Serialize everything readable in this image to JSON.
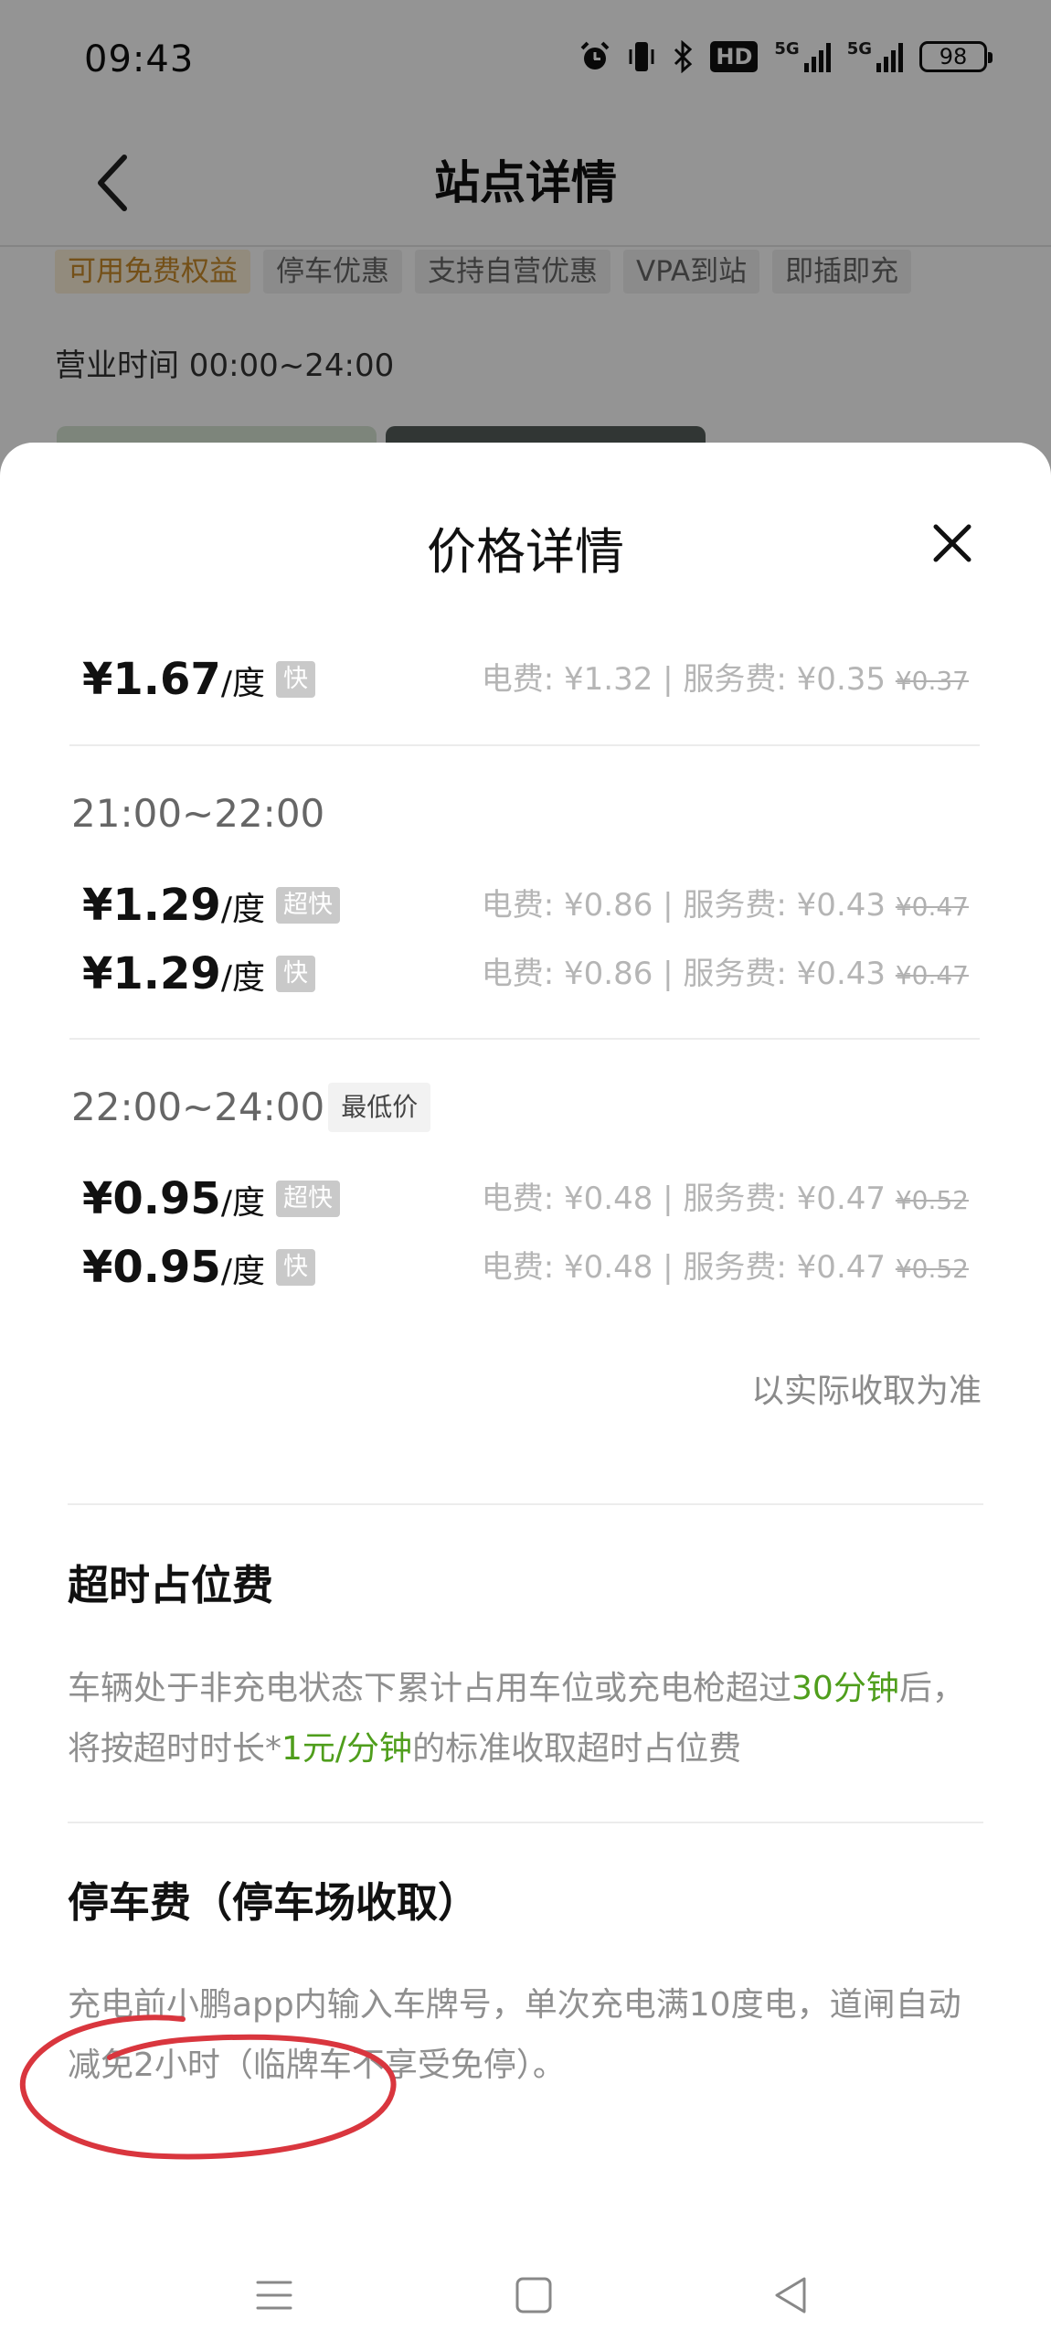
{
  "status_bar": {
    "time": "09:43",
    "icons": [
      "alarm-icon",
      "vibrate-icon",
      "bluetooth-icon",
      "hd-icon",
      "signal-5g-icon",
      "signal-5g-2-icon"
    ],
    "hd_label": "HD",
    "sig1_label": "5G",
    "sig2_label": "5G",
    "battery": "98"
  },
  "nav": {
    "title": "站点详情",
    "back_icon": "chevron-left-icon"
  },
  "station": {
    "tags": [
      "可用免费权益",
      "停车优惠",
      "支持自营优惠",
      "VPA到站",
      "即插即充"
    ],
    "hours": "营业时间 00:00~24:00"
  },
  "sheet": {
    "title": "价格详情",
    "close_icon": "close-icon",
    "rows": [
      {
        "price": "¥1.67",
        "unit": "/度",
        "speed": "快",
        "detail": "电费: ¥1.32 | 服务费: ¥0.35 ",
        "original": "¥0.37"
      },
      {
        "price": "¥1.29",
        "unit": "/度",
        "speed": "超快",
        "detail": "电费: ¥0.86 | 服务费: ¥0.43 ",
        "original": "¥0.47"
      },
      {
        "price": "¥1.29",
        "unit": "/度",
        "speed": "快",
        "detail": "电费: ¥0.86 | 服务费: ¥0.43 ",
        "original": "¥0.47"
      },
      {
        "price": "¥0.95",
        "unit": "/度",
        "speed": "超快",
        "detail": "电费: ¥0.48 | 服务费: ¥0.47 ",
        "original": "¥0.52"
      },
      {
        "price": "¥0.95",
        "unit": "/度",
        "speed": "快",
        "detail": "电费: ¥0.48 | 服务费: ¥0.47 ",
        "original": "¥0.52"
      }
    ],
    "periods": [
      {
        "label": "21:00~22:00"
      },
      {
        "label": "22:00~24:00",
        "badge": "最低价"
      }
    ],
    "note": "以实际收取为准",
    "overtime": {
      "title": "超时占位费",
      "text_1": "车辆处于非充电状态下累计占用车位或充电枪超过",
      "highlight_1": "30分钟",
      "text_2": "后，将按超时时长*",
      "highlight_2": "1元/分钟",
      "text_3": "的标准收取超时占位费"
    },
    "parking": {
      "title": "停车费（停车场收取）",
      "text": "充电前小鹏app内输入车牌号，单次充电满10度电，道闸自动减免2小时（临牌车不享受免停）。"
    }
  },
  "system_nav": {
    "icons": [
      "menu-icon",
      "home-square-icon",
      "back-triangle-icon"
    ]
  },
  "colors": {
    "accent_green": "#4f9e1c",
    "annotation_red": "#d9363e",
    "tag_highlight": "#c88a2a"
  }
}
